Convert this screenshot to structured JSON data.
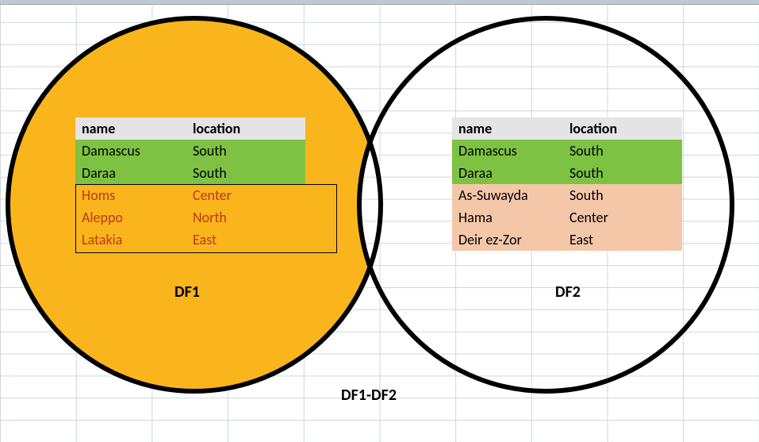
{
  "labels": {
    "df1": "DF1",
    "df2": "DF2",
    "center": "DF1-DF2"
  },
  "columns": {
    "name": "name",
    "location": "location"
  },
  "table1": {
    "rows": [
      {
        "name": "Damascus",
        "location": "South",
        "cls": "green"
      },
      {
        "name": "Daraa",
        "location": "South",
        "cls": "green"
      },
      {
        "name": "Homs",
        "location": "Center",
        "cls": "orange"
      },
      {
        "name": "Aleppo",
        "location": "North",
        "cls": "orange"
      },
      {
        "name": "Latakia",
        "location": "East",
        "cls": "orange"
      }
    ]
  },
  "table2": {
    "rows": [
      {
        "name": "Damascus",
        "location": "South",
        "cls": "green"
      },
      {
        "name": "Daraa",
        "location": "South",
        "cls": "green"
      },
      {
        "name": "As-Suwayda",
        "location": "South",
        "cls": "peach"
      },
      {
        "name": "Hama",
        "location": "Center",
        "cls": "peach"
      },
      {
        "name": "Deir ez-Zor",
        "location": "East",
        "cls": "peach"
      }
    ]
  },
  "colors": {
    "accent_orange": "#f9b51b",
    "green": "#7dc242",
    "peach": "#f5c7a9",
    "red_text": "#c0361d"
  }
}
